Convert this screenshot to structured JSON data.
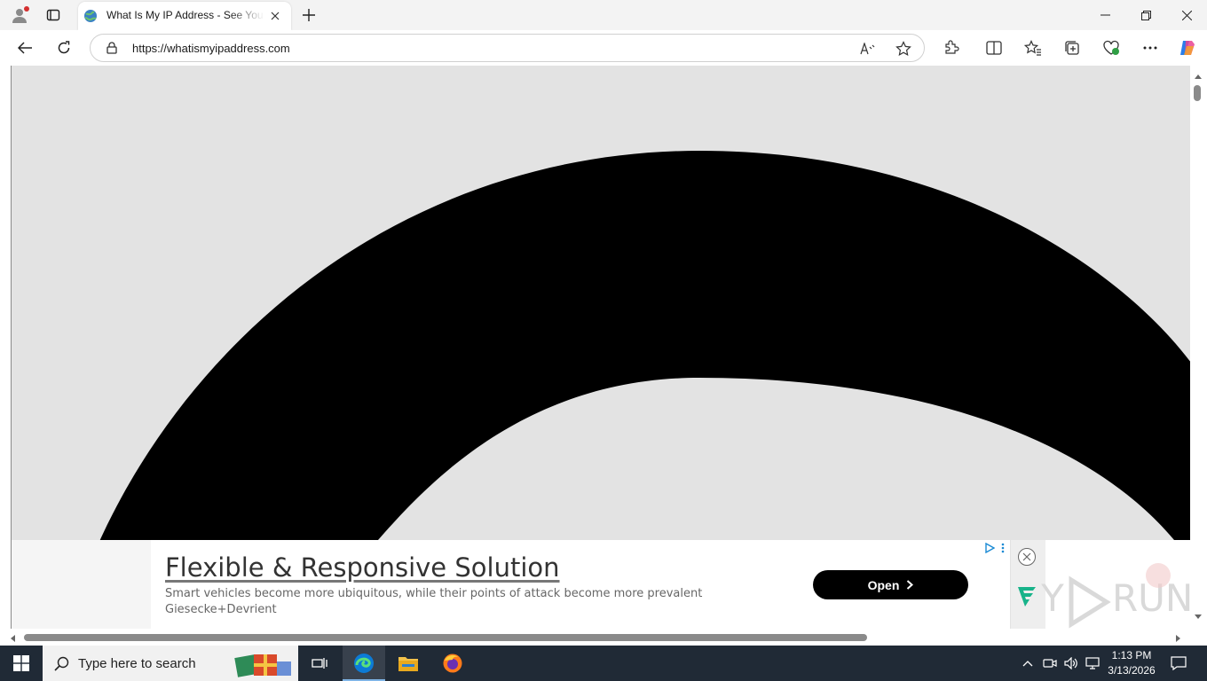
{
  "browser": {
    "tab": {
      "title": "What Is My IP Address - See Your"
    },
    "address_bar": {
      "url": "https://whatismyipaddress.com"
    }
  },
  "ad": {
    "title": "Flexible & Responsive Solution",
    "description": "Smart vehicles become more ubiquitous, while their points of attack become more prevalent",
    "brand": "Giesecke+Devrient",
    "open_label": "Open"
  },
  "watermark": {
    "text": "ANY RUN"
  },
  "taskbar": {
    "search_placeholder": "Type here to search",
    "time": "1:13 PM",
    "date": "3/13/2026"
  },
  "colors": {
    "page_bg": "#e3e3e3",
    "arc": "#000000",
    "taskbar": "#202a36",
    "edge_accent": "#0c7bd6"
  }
}
